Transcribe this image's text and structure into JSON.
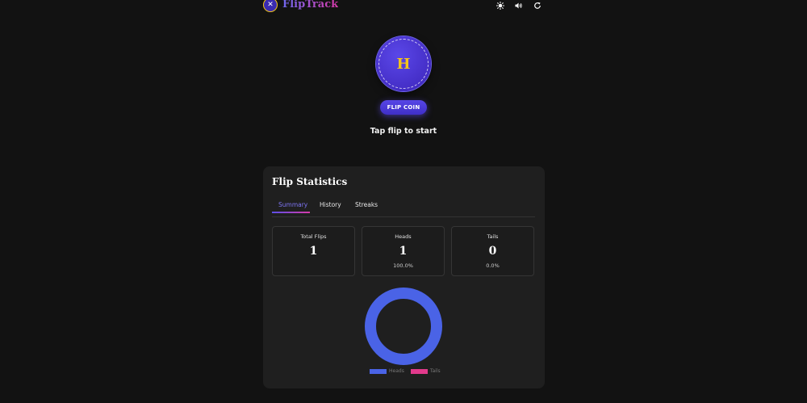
{
  "header": {
    "logo_glyph": "✕",
    "brand": "FlipTrack",
    "icons": [
      "theme-toggle-icon",
      "sound-icon",
      "reset-icon"
    ]
  },
  "coin": {
    "face": "H",
    "button_label": "FLIP COIN",
    "status": "Tap flip to start"
  },
  "stats": {
    "title": "Flip Statistics",
    "tabs": [
      {
        "label": "Summary",
        "active": true
      },
      {
        "label": "History",
        "active": false
      },
      {
        "label": "Streaks",
        "active": false
      }
    ],
    "total": {
      "label": "Total Flips",
      "value": "1"
    },
    "heads": {
      "label": "Heads",
      "value": "1",
      "pct": "100.0%"
    },
    "tails": {
      "label": "Tails",
      "value": "0",
      "pct": "0.0%"
    }
  },
  "chart_data": {
    "type": "pie",
    "categories": [
      "Heads",
      "Tails"
    ],
    "values": [
      1,
      0
    ],
    "colors": [
      "#4a63e6",
      "#e23a8c"
    ],
    "legend": "bottom"
  },
  "colors": {
    "background": "#121212",
    "card": "#1f1f1f",
    "accent": "#5746e6",
    "heads": "#4a63e6",
    "tails": "#e23a8c",
    "coin_letter": "#f5c518"
  }
}
